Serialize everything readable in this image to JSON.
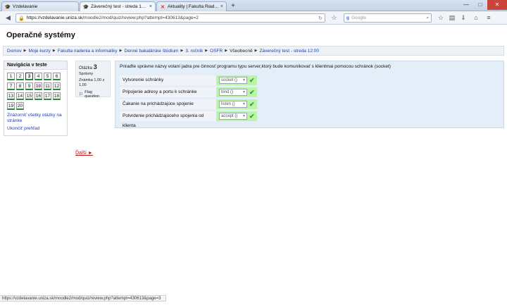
{
  "browser": {
    "tabs": [
      {
        "label": "Vzdelavanie",
        "favicon": "moodle-icon",
        "active": false
      },
      {
        "label": "Záverečný test - streda 12:00",
        "favicon": "moodle-icon",
        "active": true
      },
      {
        "label": "Aktuality | Fakulta Riadenia...",
        "favicon": "x-icon",
        "active": false
      }
    ],
    "new_tab_symbol": "+",
    "window_controls": {
      "minimize": "—",
      "maximize": "□",
      "close": "✕"
    },
    "url_host": "https://vzdelavanie.uniza.sk",
    "url_path": "/moodle2/mod/quiz/review.php?attempt=430613&page=2",
    "search_placeholder": "Google",
    "search_engine_letter": "g"
  },
  "page": {
    "title": "Operačné systémy",
    "breadcrumb": [
      {
        "label": "Domov",
        "link": true
      },
      {
        "label": "Moje kurzy",
        "link": true
      },
      {
        "label": "Fakulta riadenia a informatiky",
        "link": true
      },
      {
        "label": "Denné bakalárske štúdium",
        "link": true
      },
      {
        "label": "3. ročník",
        "link": true
      },
      {
        "label": "OSFR",
        "link": true
      },
      {
        "label": "Všeobecné",
        "link": false
      },
      {
        "label": "Záverečný test - streda 12:00",
        "link": true
      }
    ],
    "breadcrumb_separator": "▶"
  },
  "quiz_nav": {
    "heading": "Navigácia v teste",
    "questions": [
      {
        "n": "1",
        "current": false,
        "flagged": false
      },
      {
        "n": "2",
        "current": false,
        "flagged": false
      },
      {
        "n": "3",
        "current": true,
        "flagged": false
      },
      {
        "n": "4",
        "current": false,
        "flagged": false
      },
      {
        "n": "5",
        "current": false,
        "flagged": false
      },
      {
        "n": "6",
        "current": false,
        "flagged": false
      },
      {
        "n": "7",
        "current": false,
        "flagged": false
      },
      {
        "n": "8",
        "current": false,
        "flagged": false
      },
      {
        "n": "9",
        "current": false,
        "flagged": false
      },
      {
        "n": "10",
        "current": false,
        "flagged": true
      },
      {
        "n": "11",
        "current": false,
        "flagged": false
      },
      {
        "n": "12",
        "current": false,
        "flagged": false
      },
      {
        "n": "13",
        "current": false,
        "flagged": false
      },
      {
        "n": "14",
        "current": false,
        "flagged": false
      },
      {
        "n": "15",
        "current": false,
        "flagged": false
      },
      {
        "n": "16",
        "current": false,
        "flagged": false
      },
      {
        "n": "17",
        "current": false,
        "flagged": false
      },
      {
        "n": "18",
        "current": false,
        "flagged": false
      },
      {
        "n": "19",
        "current": false,
        "flagged": false
      },
      {
        "n": "20",
        "current": false,
        "flagged": false
      }
    ],
    "show_all_line1": "Znázorniť všetky otázky na",
    "show_all_line2": "stránke",
    "finish_review": "Ukončiť prehľad"
  },
  "question_info": {
    "label": "Otázka",
    "number": "3",
    "state": "Správny",
    "grade_line1": "Známka 1,00 z",
    "grade_line2": "1,00",
    "flag_label": "Flag question"
  },
  "question": {
    "text": "Priraďte správne názvy volaní jadra pre činnosť programu typu server,ktorý bude komunikovať s klientmai pomocou schránok (socket)",
    "rows": [
      {
        "stem": "Vytvorenie schránky",
        "answer": "socket ()"
      },
      {
        "stem": "Pripojenie adresy a portu k schránke",
        "answer": "bind ()"
      },
      {
        "stem": "Čakanie na prichádzajúce spojenie",
        "answer": "listen ()"
      },
      {
        "stem": "Potvrdenie prichádzajúceho spojenia od klienta",
        "answer": "accept ()"
      }
    ],
    "correct_color": "#b9f5a8"
  },
  "next_link": "Ďalší ►",
  "status_bar": "https://vzdelavanie.uniza.sk/moodle2/mod/quiz/review.php?attempt=430613&page=3"
}
